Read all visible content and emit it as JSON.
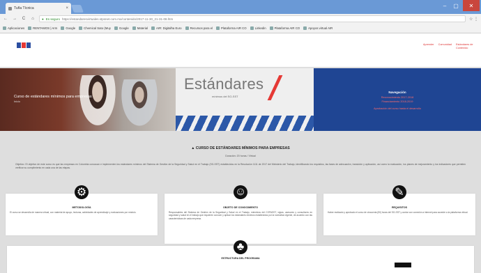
{
  "browser": {
    "tab_title": "Tuña Tícnica",
    "tab_close": "×",
    "window": {
      "min": "–",
      "max": "▢",
      "close": "✕"
    },
    "nav": {
      "back": "←",
      "forward": "→",
      "reload": "C",
      "home": "⌂"
    },
    "secure_label": "Es seguro",
    "url": "https://estandaresvirtuales.stpsnet.com.mx/contenido/2017-11-30_21-31-08.htm",
    "actions": "☆ ⋮",
    "bookmarks": [
      "Aplicaciones",
      "RENTAMOS | Arm",
      "Google",
      "Chemical Sato (Muy",
      "Google",
      "Material",
      "AIR: Digitalha Euro",
      "Recursos para el",
      "Plataforma AIR CO",
      "Linkedin",
      "Plataforma AIR CO",
      "Apoyos virtual AIR"
    ]
  },
  "header": {
    "logo_text": "STPS",
    "links": [
      "Aprender",
      "Comunidad",
      "Estándares de Contenido"
    ]
  },
  "hero": {
    "course_title": "Curso de estándares mínimos para empresas",
    "course_sub": "Inicio",
    "brand_title": "Estándares",
    "brand_sub": "mínimos del SG-SST",
    "right_title": "Navegación",
    "right_lines": [
      "Reconocimiento 2017-2018",
      "Financiamiento 2018-2019",
      "Aprobación del curso hasta el desarrollo"
    ]
  },
  "main": {
    "title": "▲ CURSO DE ESTÁNDARES MÍNIMOS PARA EMPRESAS",
    "subtitle": "Duración: 20 horas / Virtual",
    "intro": "Objetivo: El objetivo de este curso es que las empresas en Colombia conozcan e implementen los estándares mínimos del Sistema de Gestión de la Seguridad y Salud en el Trabajo (SG-SST) establecidos en la Resolución 1111 de 2017 del Ministerio del Trabajo, identificando los requisitos, las fases de adecuación, transición y aplicación, así como la evaluación, los planes de mejoramiento y los indicadores que permiten verificar su cumplimiento en cada una de las etapas."
  },
  "cards": [
    {
      "icon": "⚙",
      "title": "METODOLOGÍA",
      "body": "El curso se desarrolla de manera virtual, con material de apoyo, lecturas, actividades de aprendizaje y evaluaciones por módulo."
    },
    {
      "icon": "☺",
      "title": "OBJETO DE CONOCIMIENTO",
      "body": "Responsables del Sistema de Gestión de la Seguridad y Salud en el Trabajo, miembros del COPASST, vigías, asesores y consultores en seguridad y salud en el trabajo que requieren conocer y aplicar los estándares mínimos establecidos por la normativa vigente, de acuerdo con las características de cada empresa."
    },
    {
      "icon": "✎",
      "title": "REQUISITOS",
      "body": "Haber realizado y aprobado el curso de cincuenta (50) horas del SG-SST y contar con conexión a internet para acceder a la plataforma virtual."
    }
  ],
  "bottom": {
    "icon": "♣",
    "title": "ESTRUCTURA DEL PROGRAMA"
  }
}
